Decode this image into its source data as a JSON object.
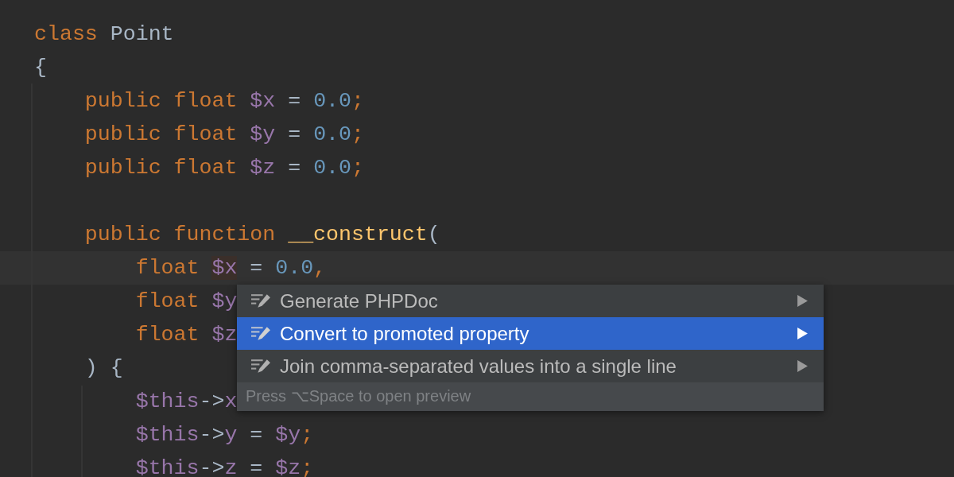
{
  "editor": {
    "lines": [
      {
        "current": false,
        "tokens": [
          {
            "text": "class",
            "kind": "keyword"
          },
          {
            "text": " Point",
            "kind": "plain"
          }
        ]
      },
      {
        "current": false,
        "tokens": [
          {
            "text": "{",
            "kind": "plain"
          }
        ]
      },
      {
        "current": false,
        "tokens": [
          {
            "text": "    public float",
            "kind": "keyword"
          },
          {
            "text": " $x",
            "kind": "var"
          },
          {
            "text": " = ",
            "kind": "plain"
          },
          {
            "text": "0.0",
            "kind": "number"
          },
          {
            "text": ";",
            "kind": "keyword"
          }
        ]
      },
      {
        "current": false,
        "tokens": [
          {
            "text": "    public float",
            "kind": "keyword"
          },
          {
            "text": " $y",
            "kind": "var"
          },
          {
            "text": " = ",
            "kind": "plain"
          },
          {
            "text": "0.0",
            "kind": "number"
          },
          {
            "text": ";",
            "kind": "keyword"
          }
        ]
      },
      {
        "current": false,
        "tokens": [
          {
            "text": "    public float",
            "kind": "keyword"
          },
          {
            "text": " $z",
            "kind": "var"
          },
          {
            "text": " = ",
            "kind": "plain"
          },
          {
            "text": "0.0",
            "kind": "number"
          },
          {
            "text": ";",
            "kind": "keyword"
          }
        ]
      },
      {
        "kind": "blank"
      },
      {
        "current": false,
        "tokens": [
          {
            "text": "    public function ",
            "kind": "keyword"
          },
          {
            "text": "__construct",
            "kind": "function"
          },
          {
            "text": "(",
            "kind": "plain"
          }
        ]
      },
      {
        "current": true,
        "tokens": [
          {
            "text": "        float ",
            "kind": "keyword"
          },
          {
            "text": "$x",
            "kind": "var-marked"
          },
          {
            "text": " = ",
            "kind": "plain"
          },
          {
            "text": "0.0",
            "kind": "number"
          },
          {
            "text": ",",
            "kind": "keyword"
          }
        ]
      },
      {
        "current": false,
        "tokens": [
          {
            "text": "        float ",
            "kind": "keyword"
          },
          {
            "text": "$y",
            "kind": "var"
          }
        ]
      },
      {
        "current": false,
        "tokens": [
          {
            "text": "        float ",
            "kind": "keyword"
          },
          {
            "text": "$z",
            "kind": "var"
          }
        ]
      },
      {
        "current": false,
        "tokens": [
          {
            "text": "    ) {",
            "kind": "plain"
          }
        ]
      },
      {
        "current": false,
        "tokens": [
          {
            "text": "        $this",
            "kind": "var"
          },
          {
            "text": "->",
            "kind": "plain"
          },
          {
            "text": "x",
            "kind": "var"
          }
        ]
      },
      {
        "current": false,
        "tokens": [
          {
            "text": "        $this",
            "kind": "var"
          },
          {
            "text": "->",
            "kind": "plain"
          },
          {
            "text": "y",
            "kind": "var"
          },
          {
            "text": " = ",
            "kind": "plain"
          },
          {
            "text": "$y",
            "kind": "var"
          },
          {
            "text": ";",
            "kind": "keyword"
          }
        ]
      },
      {
        "current": false,
        "tokens": [
          {
            "text": "        $this",
            "kind": "var"
          },
          {
            "text": "->",
            "kind": "plain"
          },
          {
            "text": "z",
            "kind": "var"
          },
          {
            "text": " = ",
            "kind": "plain"
          },
          {
            "text": "$z",
            "kind": "var"
          },
          {
            "text": ";",
            "kind": "keyword"
          }
        ]
      }
    ]
  },
  "popup": {
    "items": [
      {
        "label": "Generate PHPDoc",
        "selected": false,
        "submenu": true
      },
      {
        "label": "Convert to promoted property",
        "selected": true,
        "submenu": true
      },
      {
        "label": "Join comma-separated values into a single line",
        "selected": false,
        "submenu": true
      }
    ],
    "hint": "Press ⌥Space to open preview"
  }
}
